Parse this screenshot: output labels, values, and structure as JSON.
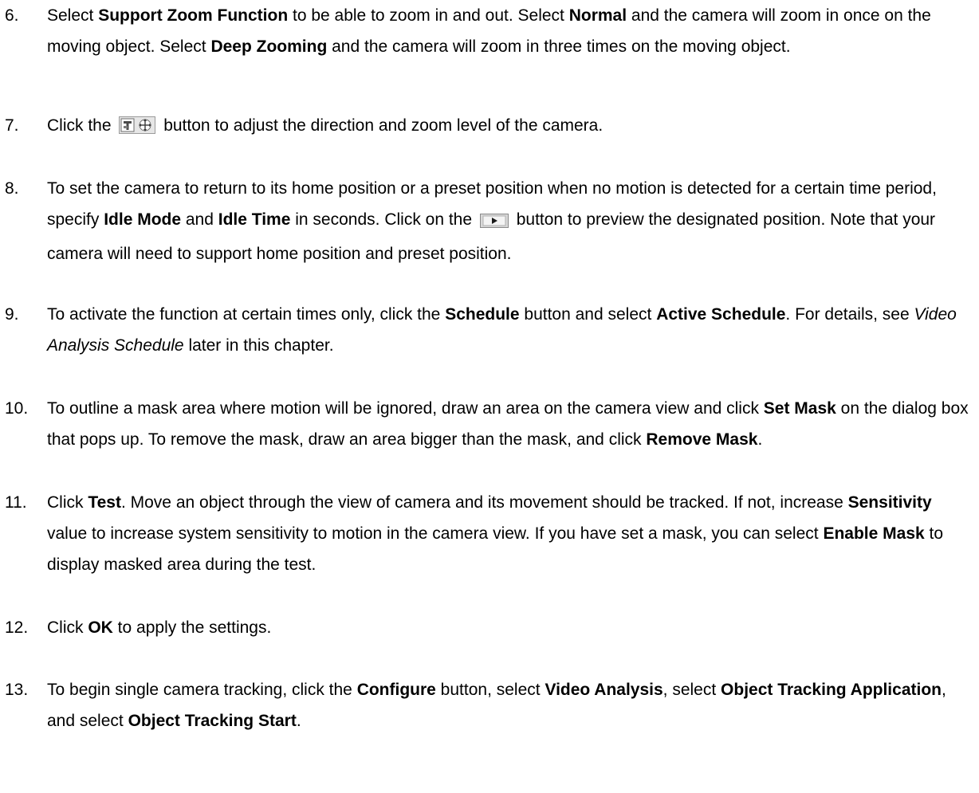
{
  "steps": [
    {
      "number": "6.",
      "parts": [
        {
          "t": "Select "
        },
        {
          "t": "Support Zoom Function",
          "b": true
        },
        {
          "t": " to be able to zoom in and out. Select "
        },
        {
          "t": "Normal",
          "b": true
        },
        {
          "t": " and the camera will zoom in once on the moving object. Select "
        },
        {
          "t": "Deep Zooming",
          "b": true
        },
        {
          "t": " and the camera will zoom in three times on the moving object."
        }
      ]
    },
    {
      "number": "7.",
      "parts": [
        {
          "t": "Click the "
        },
        {
          "icon": "ptz-control-icon"
        },
        {
          "t": " button to adjust the direction and zoom level of the camera."
        }
      ]
    },
    {
      "number": "8.",
      "parts": [
        {
          "t": "To set the camera to return to its home position or a preset position when no motion is detected for a certain time period, specify "
        },
        {
          "t": "Idle Mode",
          "b": true
        },
        {
          "t": " and "
        },
        {
          "t": "Idle Time",
          "b": true
        },
        {
          "t": " in seconds. Click on the "
        },
        {
          "icon": "play-preview-icon"
        },
        {
          "t": " button to preview the designated position. Note that your camera will need to support home position and preset position."
        }
      ]
    },
    {
      "number": "9.",
      "parts": [
        {
          "t": "To activate the function at certain times only, click the "
        },
        {
          "t": "Schedule",
          "b": true
        },
        {
          "t": " button and select "
        },
        {
          "t": "Active Schedule",
          "b": true
        },
        {
          "t": ". For details, see "
        },
        {
          "t": "Video Analysis Schedule",
          "i": true
        },
        {
          "t": " later in this chapter."
        }
      ]
    },
    {
      "number": "10.",
      "parts": [
        {
          "t": "To outline a mask area where motion will be ignored, draw an area on the camera view and click "
        },
        {
          "t": "Set Mask",
          "b": true
        },
        {
          "t": " on the dialog box that pops up. To remove the mask, draw an area bigger than the mask, and click "
        },
        {
          "t": "Remove Mask",
          "b": true
        },
        {
          "t": "."
        }
      ]
    },
    {
      "number": "11.",
      "parts": [
        {
          "t": "Click "
        },
        {
          "t": "Test",
          "b": true
        },
        {
          "t": ". Move an object through the view of camera and its movement should be tracked. If not, increase "
        },
        {
          "t": "Sensitivity",
          "b": true
        },
        {
          "t": " value to increase system sensitivity to motion in the camera view. If you have set a mask, you can select "
        },
        {
          "t": "Enable Mask",
          "b": true
        },
        {
          "t": " to display masked area during the test."
        }
      ]
    },
    {
      "number": "12.",
      "parts": [
        {
          "t": "Click "
        },
        {
          "t": "OK",
          "b": true
        },
        {
          "t": " to apply the settings."
        }
      ]
    },
    {
      "number": "13.",
      "parts": [
        {
          "t": "To begin single camera tracking, click the "
        },
        {
          "t": "Configure",
          "b": true
        },
        {
          "t": " button, select "
        },
        {
          "t": "Video Analysis",
          "b": true
        },
        {
          "t": ", select "
        },
        {
          "t": "Object Tracking Application",
          "b": true
        },
        {
          "t": ", and select "
        },
        {
          "t": "Object Tracking Start",
          "b": true
        },
        {
          "t": "."
        }
      ]
    }
  ]
}
